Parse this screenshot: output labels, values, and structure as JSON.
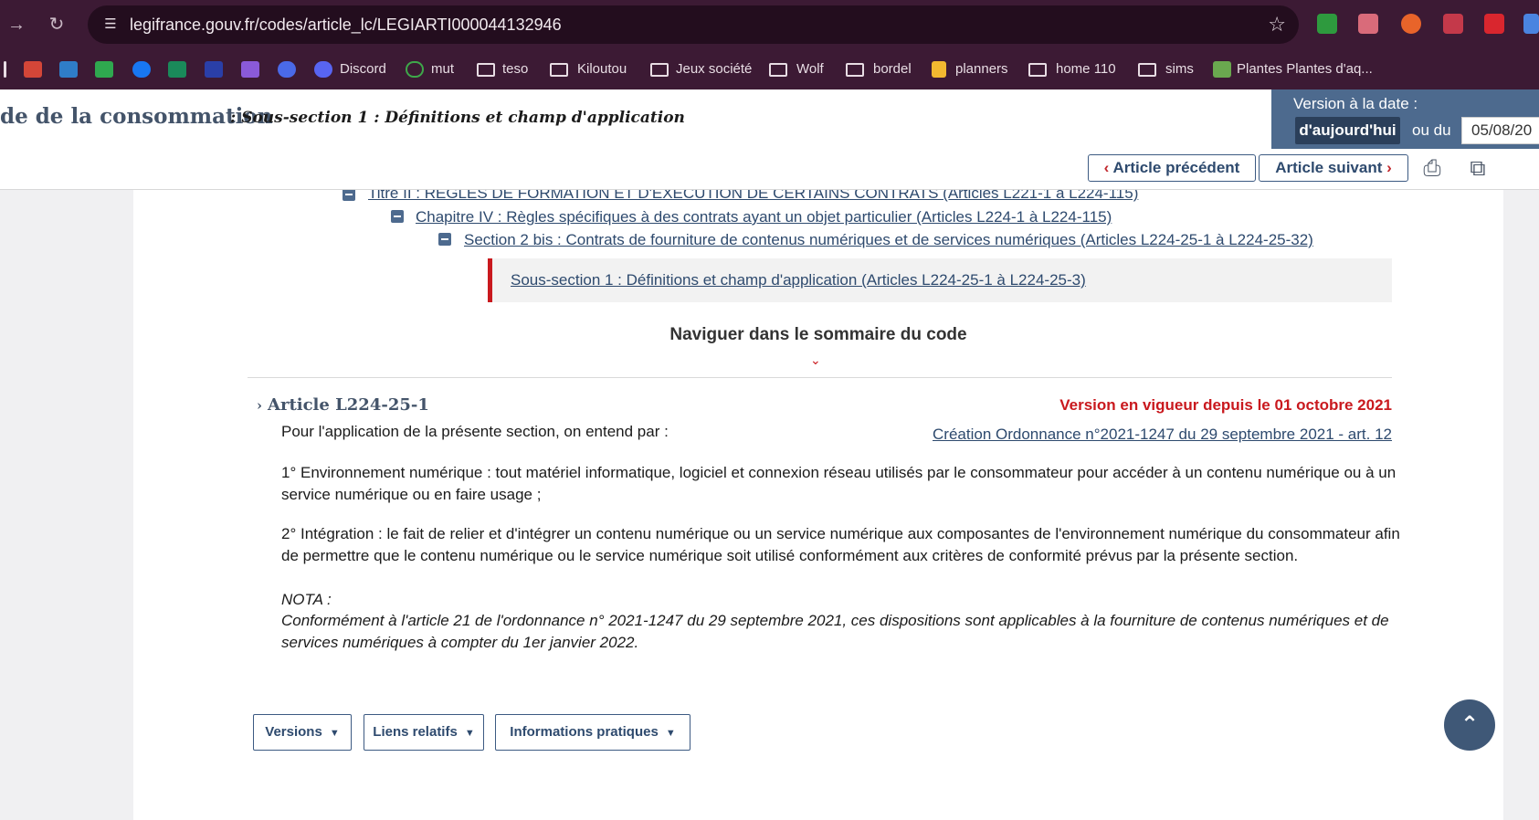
{
  "browser": {
    "url": "legifrance.gouv.fr/codes/article_lc/LEGIARTI000044132946",
    "bookmarks": [
      {
        "label": "Discord"
      },
      {
        "label": "mut"
      },
      {
        "label": "teso"
      },
      {
        "label": "Kiloutou"
      },
      {
        "label": "Jeux société"
      },
      {
        "label": "Wolf"
      },
      {
        "label": "bordel"
      },
      {
        "label": "planners"
      },
      {
        "label": "home 110"
      },
      {
        "label": "sims"
      },
      {
        "label": "Plantes Plantes d'aq..."
      }
    ]
  },
  "header": {
    "code_title": "de de la consommation",
    "subtitle": ": Sous-section 1 : Définitions et champ d'application",
    "version_label": "Version à la date :",
    "today_label": "d'aujourd'hui",
    "or_label": "ou du",
    "date_value": "05/08/20"
  },
  "toolbar": {
    "prev_label": "Article précédent",
    "next_label": "Article suivant"
  },
  "toc": {
    "titre": "Titre II : RÈGLES DE FORMATION ET D'EXÉCUTION DE CERTAINS CONTRATS (Articles L221-1 à L224-115)",
    "chapitre": "Chapitre IV : Règles spécifiques à des contrats ayant un objet particulier (Articles L224-1 à L224-115)",
    "section": "Section 2 bis : Contrats de fourniture de contenus numériques et de services numériques (Articles L224-25-1 à L224-25-32)",
    "sous_section": "Sous-section 1 : Définitions et champ d'application (Articles L224-25-1 à L224-25-3)",
    "nav_label": "Naviguer dans le sommaire du code"
  },
  "article": {
    "title": "Article L224-25-1",
    "vigueur": "Version en vigueur depuis le 01 octobre 2021",
    "creation": "Création Ordonnance n°2021-1247 du 29 septembre 2021 - art. 12",
    "p1": "Pour l'application de la présente section, on entend par :",
    "p2": "1° Environnement numérique : tout matériel informatique, logiciel et connexion réseau utilisés par le consommateur pour accéder à un contenu numérique ou à un service numérique ou en faire usage ;",
    "p3": "2° Intégration : le fait de relier et d'intégrer un contenu numérique ou un service numérique aux composantes de l'environnement numérique du consommateur afin de permettre que le contenu numérique ou le service numérique soit utilisé conformément aux critères de conformité prévus par la présente section.",
    "nota_label": "NOTA :",
    "nota_text": "Conformément à l'article 21 de l'ordonnance n° 2021-1247 du 29 septembre 2021, ces dispositions sont applicables à la fourniture de contenus numériques et de services numériques à compter du 1er janvier 2022."
  },
  "buttons": {
    "versions": "Versions",
    "liens": "Liens relatifs",
    "infos": "Informations pratiques"
  },
  "colors": {
    "chrome": "#3c1a34",
    "accent_blue": "#2e4a6e",
    "accent_red": "#c9191e"
  }
}
